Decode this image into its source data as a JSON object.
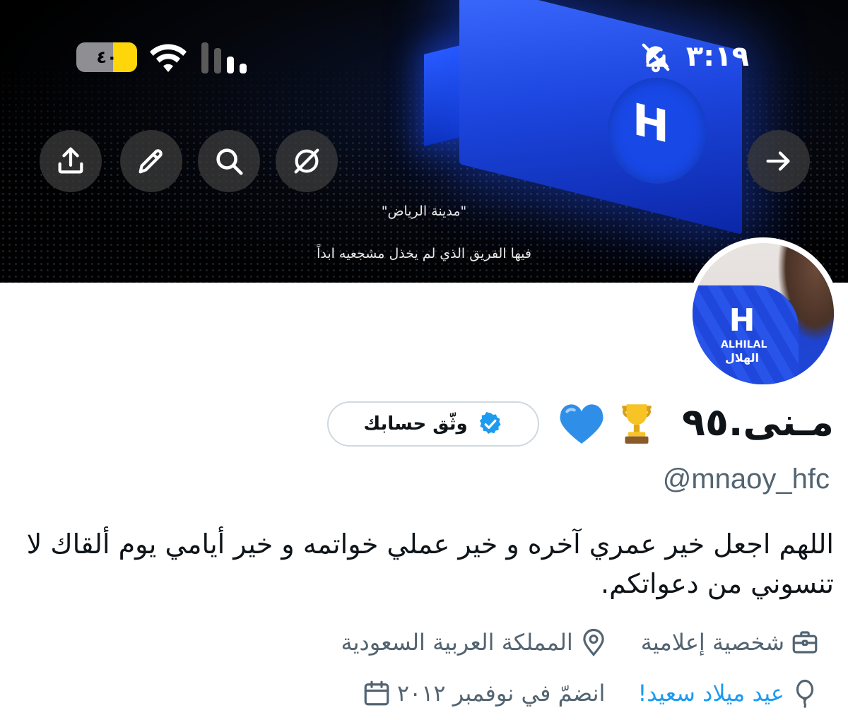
{
  "status_bar": {
    "time": "٣:١٩",
    "battery_percent": "٤٠",
    "battery_level": 0.4,
    "icons": [
      "bell-slash-icon",
      "wifi-icon",
      "cellular-signal-icon",
      "battery-icon"
    ]
  },
  "banner": {
    "caption_line1": "\"مدينة الرياض\"",
    "caption_line2": "فيها الفريق الذي لم يخذل مشجعيه ابداً",
    "buttons": [
      "back-arrow-icon",
      "circle-slash-icon",
      "search-icon",
      "pencil-icon",
      "share-icon"
    ]
  },
  "profile": {
    "display_name": "مـنى.٩٥",
    "emojis": [
      "trophy",
      "blue-heart"
    ],
    "verify_button_label": "وثّق حسابك",
    "handle": "@mnaoy_hfc",
    "bio": "اللهم اجعل خير عمري آخره و خير عملي خواتمه و خير أيامي يوم ألقاك لا تنسوني من دعواتكم.",
    "category": "شخصية إعلامية",
    "location": "المملكة العربية السعودية",
    "birthday": "عيد ميلاد سعيد!",
    "joined": "انضمّ في نوفمبر ٢٠١٢",
    "avatar_text_en": "ALHILAL",
    "avatar_text_ar": "الهلال"
  },
  "colors": {
    "accent": "#1d9bf0",
    "secondary_text": "#536471",
    "primary_text": "#0f1419",
    "battery_fill": "#ffd60a"
  }
}
